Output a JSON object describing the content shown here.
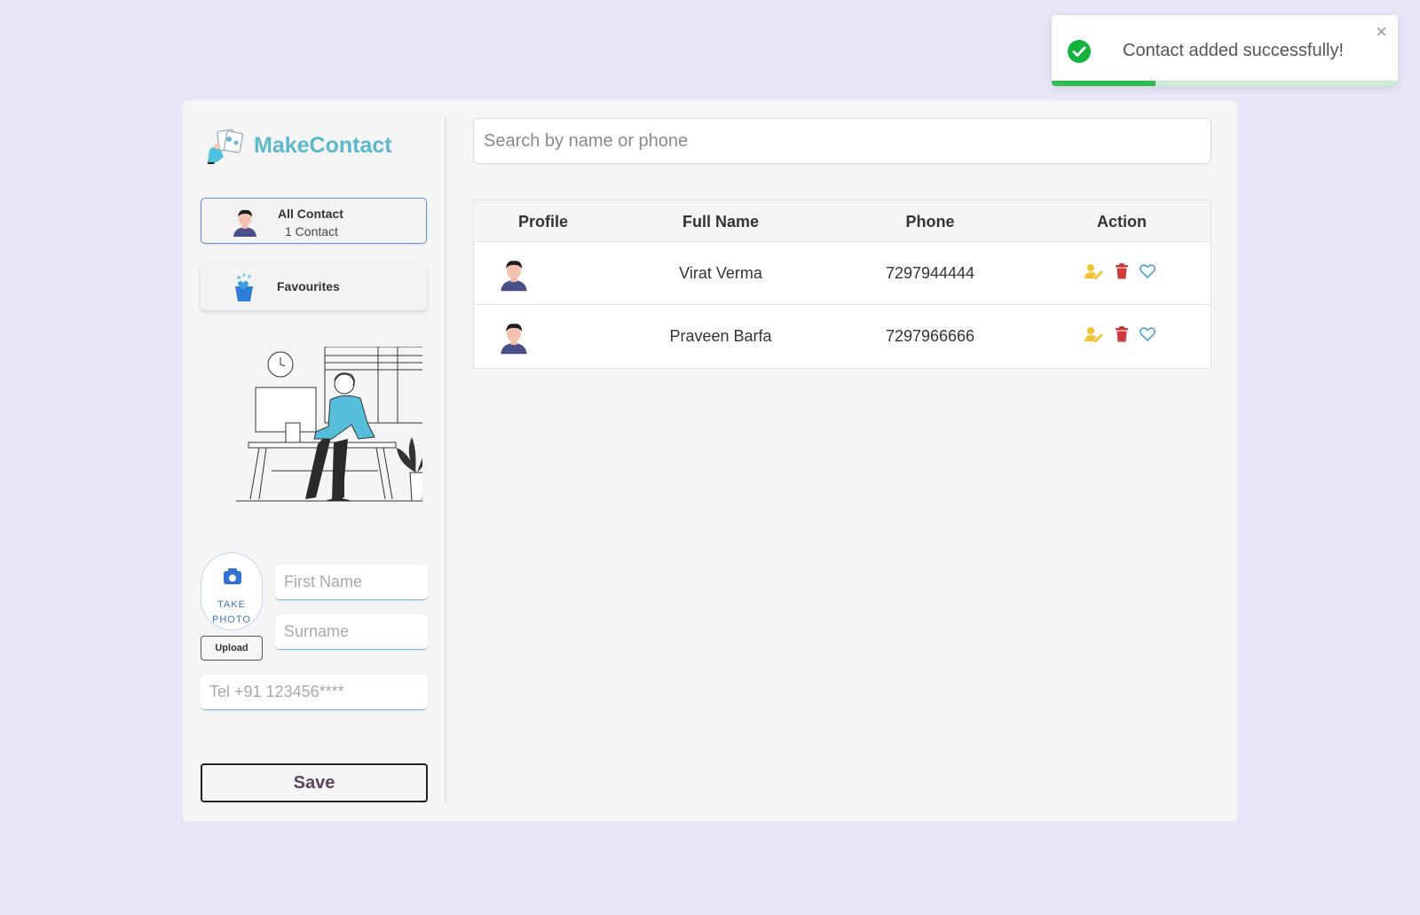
{
  "toast": {
    "message": "Contact added successfully!",
    "close_label": "×",
    "progress": 0.3,
    "icon": "check-circle-icon",
    "color": "#13b33d"
  },
  "app": {
    "name": "MakeContact",
    "brand_color": "#5bb8cc"
  },
  "sidebar": {
    "nav": [
      {
        "title": "All Contact",
        "subtitle": "1 Contact",
        "icon": "user-avatar-icon",
        "active": true
      },
      {
        "title": "Favourites",
        "icon": "favourites-basket-icon",
        "active": false
      }
    ]
  },
  "form": {
    "take_photo": "TAKE PHOTO",
    "upload_label": "Upload",
    "first_name_placeholder": "First Name",
    "surname_placeholder": "Surname",
    "tel_placeholder": "Tel +91 123456****",
    "save_label": "Save"
  },
  "search": {
    "placeholder": "Search by name or phone"
  },
  "table": {
    "headers": [
      "Profile",
      "Full Name",
      "Phone",
      "Action"
    ],
    "rows": [
      {
        "name": "Virat Verma",
        "phone": "7297944444"
      },
      {
        "name": "Praveen Barfa",
        "phone": "7297966666"
      }
    ],
    "action_icons": [
      "edit-user-icon",
      "trash-icon",
      "heart-icon"
    ],
    "action_colors": {
      "edit": "#f2c230",
      "delete": "#d1383d",
      "favourite": "#4aa3e0"
    }
  }
}
